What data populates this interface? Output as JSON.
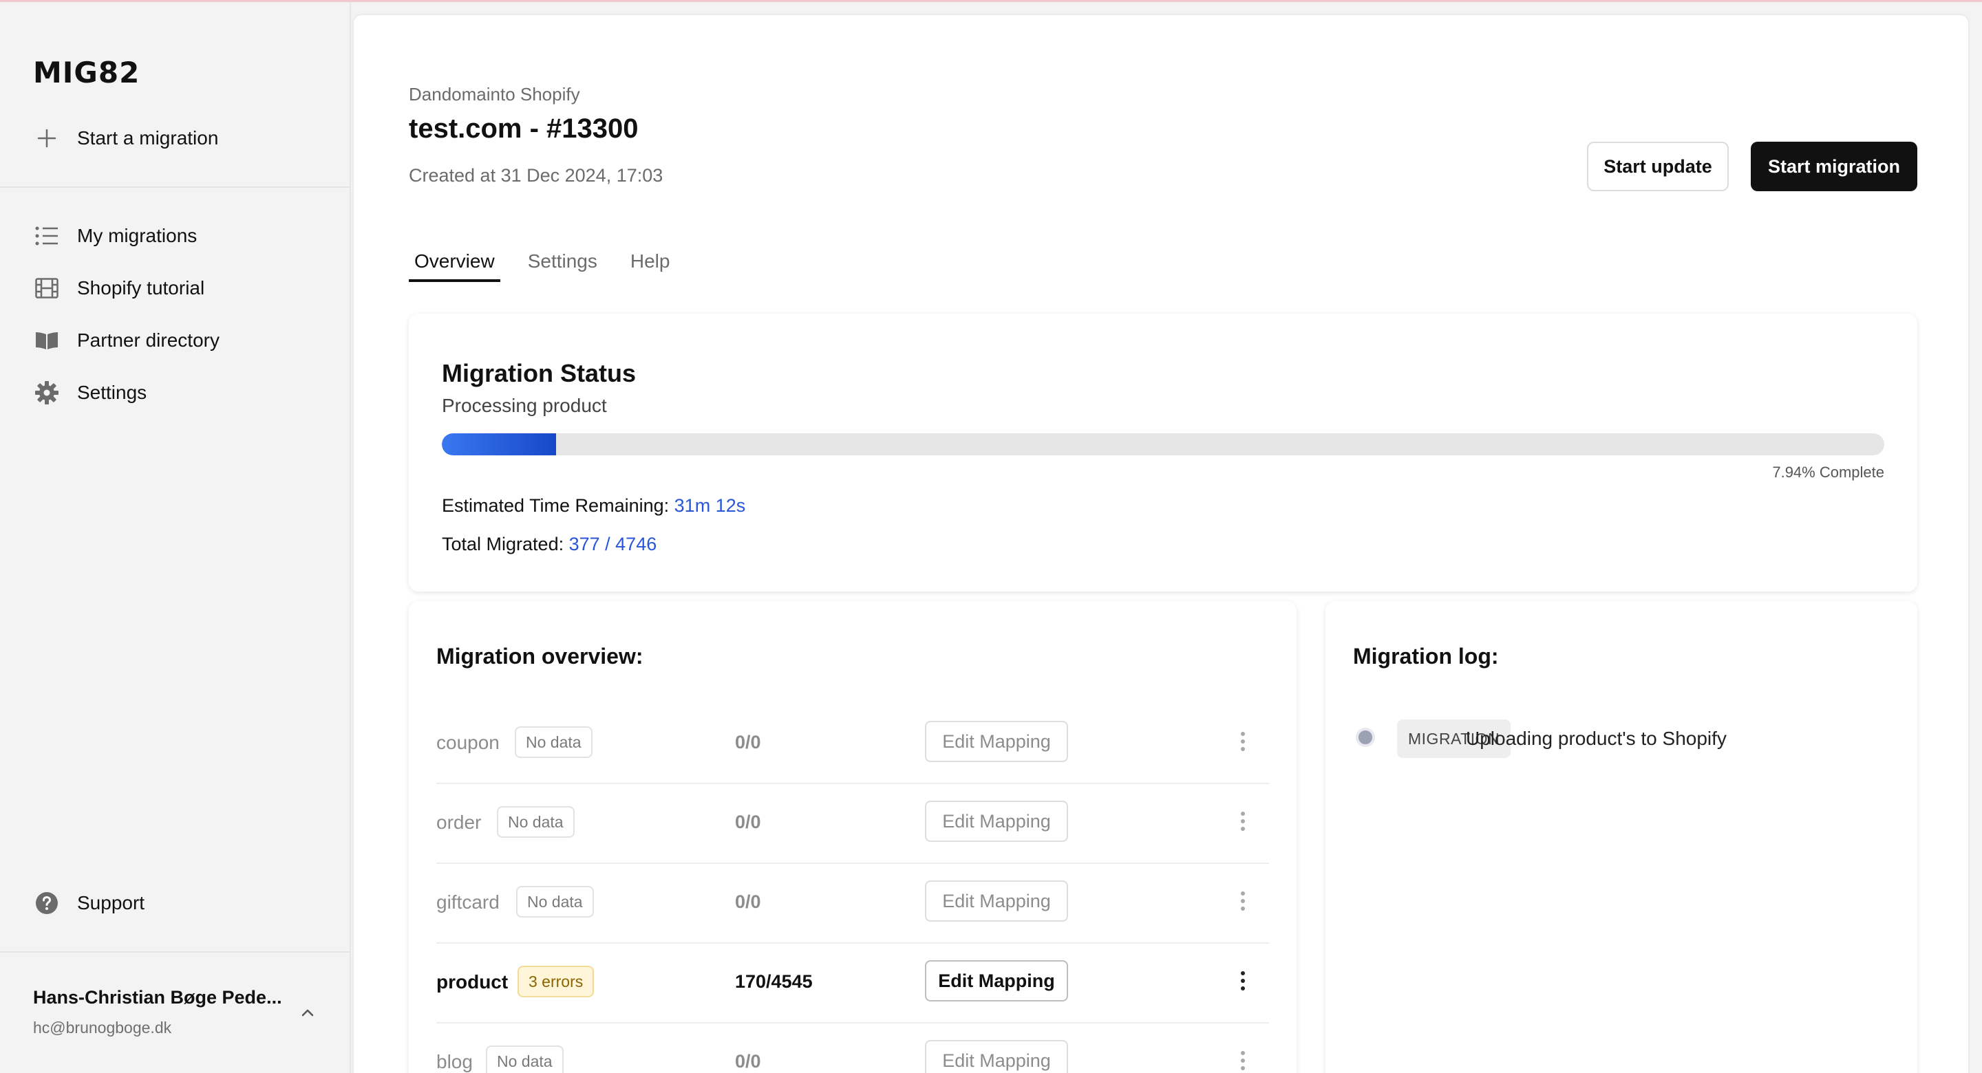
{
  "app": {
    "logo": "MIG82"
  },
  "sidebar": {
    "start_migration": "Start a migration",
    "items": [
      {
        "label": "My migrations",
        "icon": "list-icon"
      },
      {
        "label": "Shopify tutorial",
        "icon": "film-icon"
      },
      {
        "label": "Partner directory",
        "icon": "book-icon"
      },
      {
        "label": "Settings",
        "icon": "gear-icon"
      }
    ],
    "support": "Support",
    "user": {
      "name": "Hans-Christian Bøge Pede...",
      "email": "hc@brunogboge.dk"
    }
  },
  "header": {
    "subtitle": "Dandomainto Shopify",
    "title": "test.com - #13300",
    "created": "Created at 31 Dec 2024, 17:03",
    "start_update": "Start update",
    "start_migration": "Start migration"
  },
  "tabs": [
    {
      "label": "Overview",
      "active": true
    },
    {
      "label": "Settings",
      "active": false
    },
    {
      "label": "Help",
      "active": false
    }
  ],
  "status": {
    "title": "Migration Status",
    "subtitle": "Processing product",
    "progress_fraction": 0.0794,
    "progress_label": "7.94% Complete",
    "eta_label": "Estimated Time Remaining:",
    "eta_value": "31m 12s",
    "total_label": "Total Migrated:",
    "total_value": "377 / 4746",
    "accent": "#2856d8"
  },
  "overview": {
    "title": "Migration overview:",
    "rows": [
      {
        "name": "coupon",
        "badge": "No data",
        "count": "0/0",
        "button": "Edit Mapping",
        "highlight": false
      },
      {
        "name": "order",
        "badge": "No data",
        "count": "0/0",
        "button": "Edit Mapping",
        "highlight": false
      },
      {
        "name": "giftcard",
        "badge": "No data",
        "count": "0/0",
        "button": "Edit Mapping",
        "highlight": false
      },
      {
        "name": "product",
        "badge": "3 errors",
        "count": "170/4545",
        "button": "Edit Mapping",
        "highlight": true
      },
      {
        "name": "blog",
        "badge": "No data",
        "count": "0/0",
        "button": "Edit Mapping",
        "highlight": false
      }
    ]
  },
  "log": {
    "title": "Migration log:",
    "entries": [
      {
        "tag": "MIGRATION",
        "message": "Uploading product's to Shopify"
      }
    ]
  }
}
